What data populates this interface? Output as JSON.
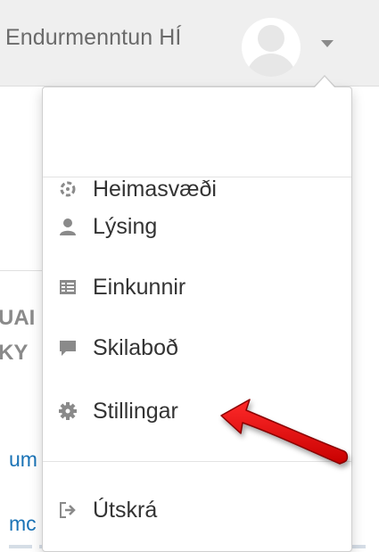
{
  "navbar": {
    "user_name": "Endurmenntun HÍ"
  },
  "background": {
    "heading_line_1": "UAI",
    "heading_line_2": "KY",
    "link_1": "um",
    "link_2": "mc"
  },
  "menu": {
    "items": [
      {
        "label": "Heimasvæði",
        "icon": "dashboard-icon"
      },
      {
        "label": "Lýsing",
        "icon": "user-icon"
      },
      {
        "label": "Einkunnir",
        "icon": "grades-table-icon"
      },
      {
        "label": "Skilaboð",
        "icon": "message-bubble-icon"
      },
      {
        "label": "Stillingar",
        "icon": "gear-icon"
      },
      {
        "label": "Útskrá",
        "icon": "logout-icon"
      }
    ]
  },
  "colors": {
    "navbar_bg": "#efefef",
    "menu_text": "#333333",
    "icon_gray": "#8a8a8a",
    "link_blue": "#1a73b6",
    "annotation_red": "#e60000"
  }
}
